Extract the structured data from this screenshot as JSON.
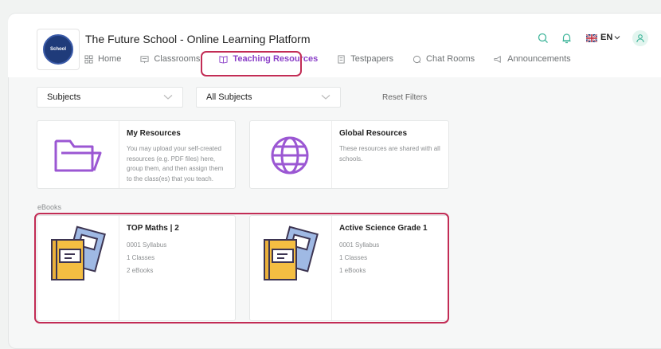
{
  "header": {
    "title": "The Future School - Online Learning Platform",
    "logo_text": "School",
    "language": "EN"
  },
  "nav": [
    {
      "label": "Home",
      "icon": "grid-icon"
    },
    {
      "label": "Classrooms",
      "icon": "classroom-icon"
    },
    {
      "label": "Teaching Resources",
      "icon": "book-icon",
      "active": true
    },
    {
      "label": "Testpapers",
      "icon": "testpaper-icon"
    },
    {
      "label": "Chat Rooms",
      "icon": "chat-icon"
    },
    {
      "label": "Announcements",
      "icon": "megaphone-icon"
    }
  ],
  "filters": {
    "subjects": "Subjects",
    "all_subjects": "All Subjects",
    "reset": "Reset Filters"
  },
  "resources": [
    {
      "title": "My Resources",
      "desc": "You may upload your self-created resources (e.g. PDF files) here, group them, and then assign them to the class(es) that you teach."
    },
    {
      "title": "Global Resources",
      "desc": "These resources are shared with all schools."
    }
  ],
  "ebooks_label": "eBooks",
  "ebooks": [
    {
      "title": "TOP Maths | 2",
      "syllabus": "0001 Syllabus",
      "classes": "1 Classes",
      "ebooks": "2 eBooks"
    },
    {
      "title": "Active Science Grade 1",
      "syllabus": "0001 Syllabus",
      "classes": "1 Classes",
      "ebooks": "1 eBooks"
    }
  ],
  "colors": {
    "accent": "#8a3fc8",
    "highlight": "#c22c55",
    "teal": "#3fb59a"
  }
}
